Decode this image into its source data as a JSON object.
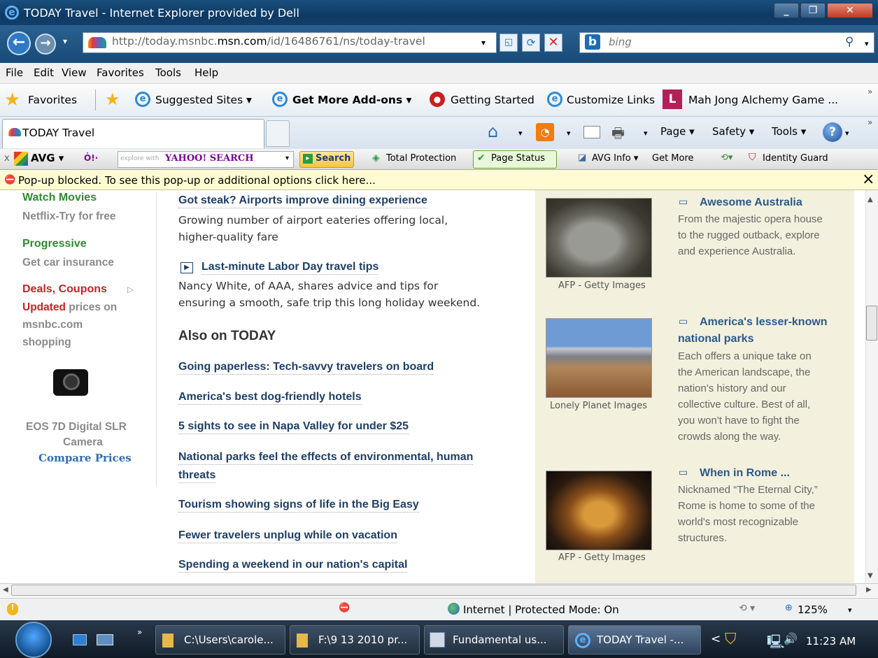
{
  "window": {
    "title": "TODAY Travel - Internet Explorer provided by Dell"
  },
  "address": {
    "url_prefix": "http://today.msnbc.",
    "url_domain": "msn.com",
    "url_suffix": "/id/16486761/ns/today-travel",
    "search_placeholder": "bing",
    "search_logo": "b"
  },
  "menu": [
    "File",
    "Edit",
    "View",
    "Favorites",
    "Tools",
    "Help"
  ],
  "favorites": {
    "label": "Favorites",
    "suggested": "Suggested Sites ▾",
    "addons": "Get More Add-ons ▾",
    "getting_started": "Getting Started",
    "customize": "Customize Links",
    "game": "Mah Jong Alchemy Game ..."
  },
  "tab": {
    "label": "TODAY Travel"
  },
  "commandbar": {
    "page": "Page ▾",
    "safety": "Safety ▾",
    "tools": "Tools ▾"
  },
  "avg": {
    "close": "x",
    "brand": "AVG ▾",
    "yahoo_pre": "explore with",
    "yahoo": "YAHOO! SEARCH",
    "search": "Search",
    "total": "Total Protection",
    "status": "Page Status",
    "info": "AVG Info ▾",
    "more": "Get More",
    "identity": "Identity Guard"
  },
  "popup": {
    "text": "Pop-up blocked. To see this pop-up or additional options click here...",
    "close": "×"
  },
  "left": {
    "netflix_title": "Watch Movies",
    "netflix_sub": "Netflix-Try for free",
    "progressive_title": "Progressive",
    "progressive_sub": "Get car insurance",
    "deals_title": "Deals, Coupons",
    "deals_updated": "Updated",
    "deals_line1": " prices on",
    "deals_line2": "msnbc.com",
    "deals_line3": "shopping",
    "camera_line1": "EOS 7D Digital SLR",
    "camera_line2": "Camera",
    "compare": "Compare Prices"
  },
  "middle": {
    "story1_title": "Got steak? Airports improve dining experience",
    "story1_text1": "Growing number of airport eateries offering local,",
    "story1_text2": "higher-quality fare",
    "story2_title": "Last-minute Labor Day travel tips",
    "story2_text1": "Nancy White, of AAA, shares advice and tips for",
    "story2_text2": "ensuring a smooth, safe trip this long holiday weekend.",
    "also_heading": "Also on TODAY",
    "links": [
      "Going paperless: Tech-savvy travelers on board",
      "America's best dog-friendly hotels",
      "5 sights to see in Napa Valley for under $25",
      "National parks feel the effects of environmental, human",
      "threats",
      "Tourism showing signs of life in the Big Easy",
      "Fewer travelers unplug while on vacation",
      "Spending a weekend in our nation's capital"
    ]
  },
  "right": {
    "item1_title": "Awesome Australia",
    "item1_lines": [
      "From the majestic opera house",
      "to the rugged outback, explore",
      "and experience Australia."
    ],
    "item1_credit": "AFP - Getty Images",
    "item2_title1": "America's lesser-known",
    "item2_title2": "national parks",
    "item2_lines": [
      "Each offers a unique take on",
      "the American landscape, the",
      "nation's history and our",
      "collective culture. Best of all,",
      "you won't have to fight the",
      "crowds along the way."
    ],
    "item2_credit": "Lonely Planet Images",
    "item3_title": "When in Rome ...",
    "item3_lines": [
      "Nicknamed “The Eternal City,”",
      "Rome is home to some of the",
      "world's most recognizable",
      "structures."
    ],
    "item3_credit": "AFP - Getty Images"
  },
  "status": {
    "zone": "Internet | Protected Mode: On",
    "zoom": "125%"
  },
  "taskbar": {
    "items": [
      "C:\\Users\\carole...",
      "F:\\9 13 2010 pr...",
      "Fundamental us...",
      "TODAY Travel -..."
    ],
    "clock": "11:23 AM"
  },
  "colors": {
    "accent": "#1f4e79",
    "progressive": "#2e8b2e",
    "deals": "#cc2222",
    "netflix": "#2e8b2e"
  }
}
